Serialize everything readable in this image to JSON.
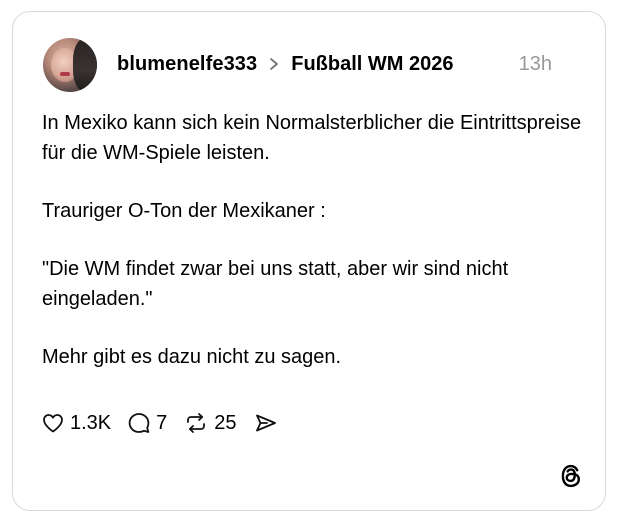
{
  "post": {
    "username": "blumenelfe333",
    "topic": "Fußball WM 2026",
    "time": "13h",
    "paragraphs": [
      "In Mexiko kann sich kein Normalsterblicher die Eintrittspreise für die WM-Spiele leisten.",
      "Trauriger O-Ton der Mexikaner :",
      "\"Die WM findet zwar bei uns statt, aber wir sind nicht eingeladen.\"",
      "Mehr gibt es dazu nicht zu sagen."
    ]
  },
  "actions": {
    "likes": "1.3K",
    "replies": "7",
    "reposts": "25",
    "icons": {
      "like": "heart-icon",
      "reply": "comment-bubble-icon",
      "repost": "repost-icon",
      "share": "send-icon"
    }
  },
  "branding": {
    "logo": "threads-logo-icon"
  },
  "colors": {
    "text": "#000000",
    "muted": "#999999",
    "border": "#d9d9d9"
  }
}
